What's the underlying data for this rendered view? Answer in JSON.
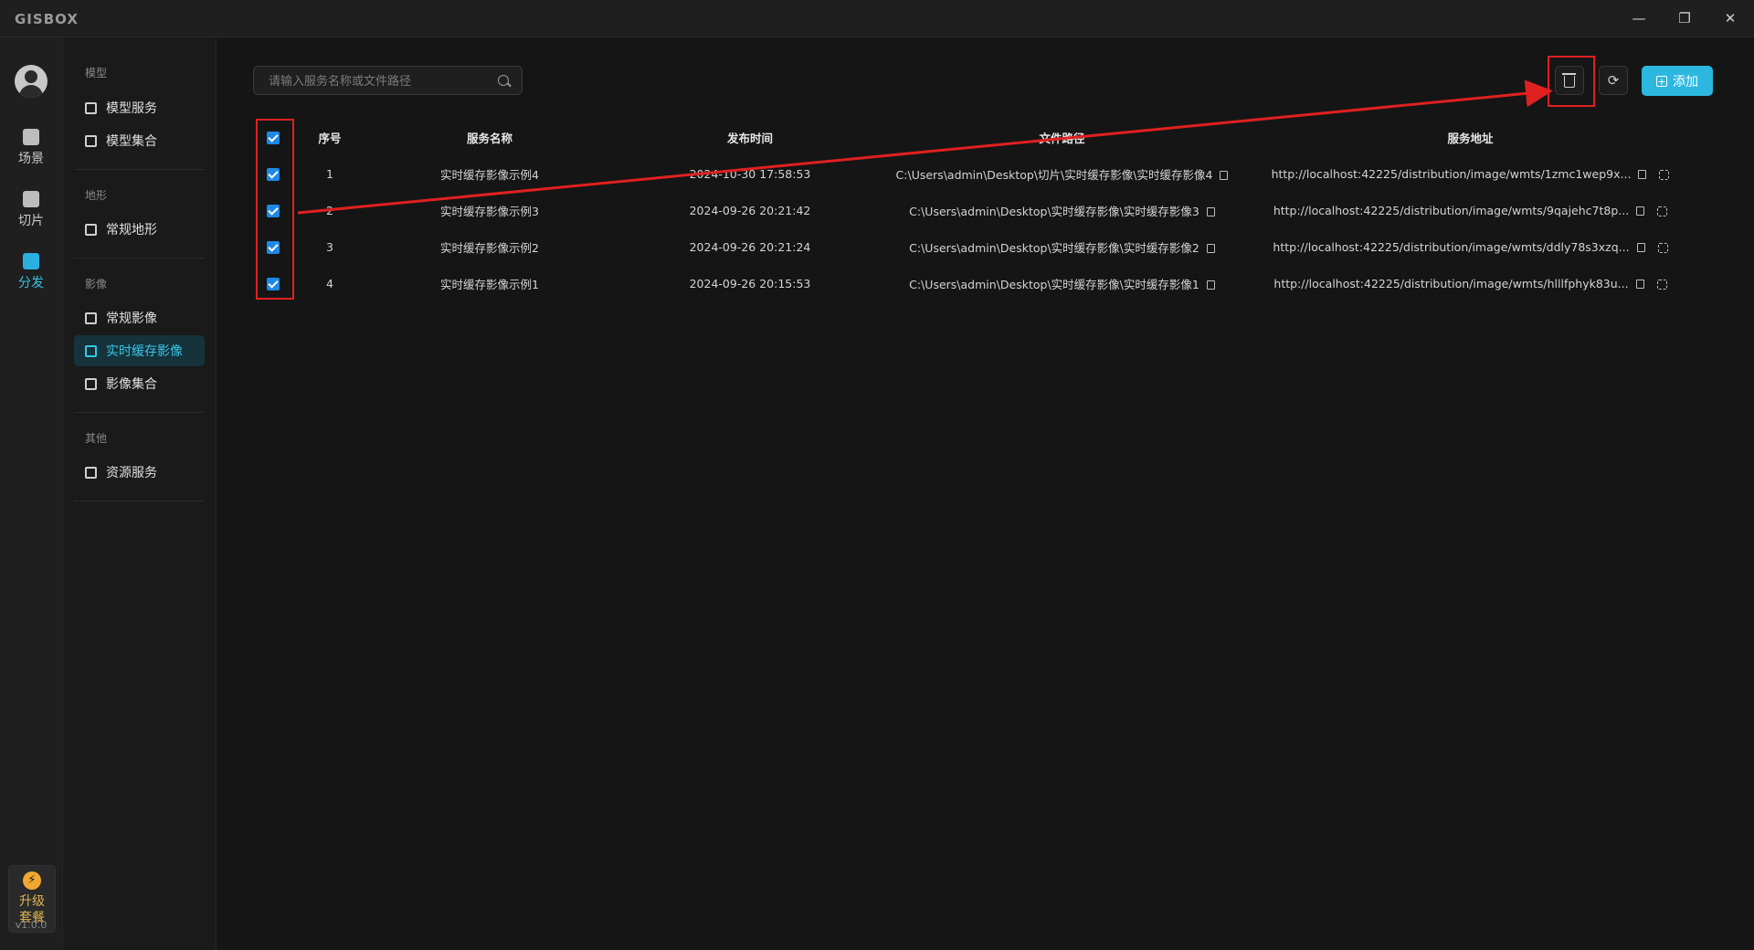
{
  "app": {
    "logo": "GISBOX",
    "version": "v1.0.0"
  },
  "window": {
    "minimize_icon": "minimize-icon",
    "restore_icon": "restore-icon",
    "close_icon": "close-icon"
  },
  "rail": {
    "items": [
      {
        "label": "场景",
        "icon": "scene-icon"
      },
      {
        "label": "切片",
        "icon": "slice-icon"
      },
      {
        "label": "分发",
        "icon": "distribute-icon"
      }
    ],
    "upgrade": {
      "line1": "升级",
      "line2": "套餐"
    }
  },
  "subnav": {
    "groups": [
      {
        "title": "模型",
        "items": [
          "模型服务",
          "模型集合"
        ]
      },
      {
        "title": "地形",
        "items": [
          "常规地形"
        ]
      },
      {
        "title": "影像",
        "items": [
          "常规影像",
          "实时缓存影像",
          "影像集合"
        ]
      },
      {
        "title": "其他",
        "items": [
          "资源服务"
        ]
      }
    ],
    "active": "实时缓存影像"
  },
  "toolbar": {
    "search_placeholder": "请输入服务名称或文件路径",
    "add_label": "添加",
    "delete_icon": "trash-icon",
    "refresh_icon": "refresh-icon"
  },
  "table": {
    "columns": [
      "序号",
      "服务名称",
      "发布时间",
      "文件路径",
      "服务地址"
    ],
    "rows": [
      {
        "index": "1",
        "name": "实时缓存影像示例4",
        "time": "2024-10-30 17:58:53",
        "path": "C:\\Users\\admin\\Desktop\\切片\\实时缓存影像\\实时缓存影像4",
        "url": "http://localhost:42225/distribution/image/wmts/1zmc1wep9x...",
        "checked": true
      },
      {
        "index": "2",
        "name": "实时缓存影像示例3",
        "time": "2024-09-26 20:21:42",
        "path": "C:\\Users\\admin\\Desktop\\实时缓存影像\\实时缓存影像3",
        "url": "http://localhost:42225/distribution/image/wmts/9qajehc7t8p...",
        "checked": true
      },
      {
        "index": "3",
        "name": "实时缓存影像示例2",
        "time": "2024-09-26 20:21:24",
        "path": "C:\\Users\\admin\\Desktop\\实时缓存影像\\实时缓存影像2",
        "url": "http://localhost:42225/distribution/image/wmts/ddly78s3xzq...",
        "checked": true
      },
      {
        "index": "4",
        "name": "实时缓存影像示例1",
        "time": "2024-09-26 20:15:53",
        "path": "C:\\Users\\admin\\Desktop\\实时缓存影像\\实时缓存影像1",
        "url": "http://localhost:42225/distribution/image/wmts/hlllfphyk83u...",
        "checked": true
      }
    ]
  },
  "colors": {
    "accent": "#2bb7e0",
    "annotation": "#e02020",
    "checkbox": "#1e88e5"
  }
}
